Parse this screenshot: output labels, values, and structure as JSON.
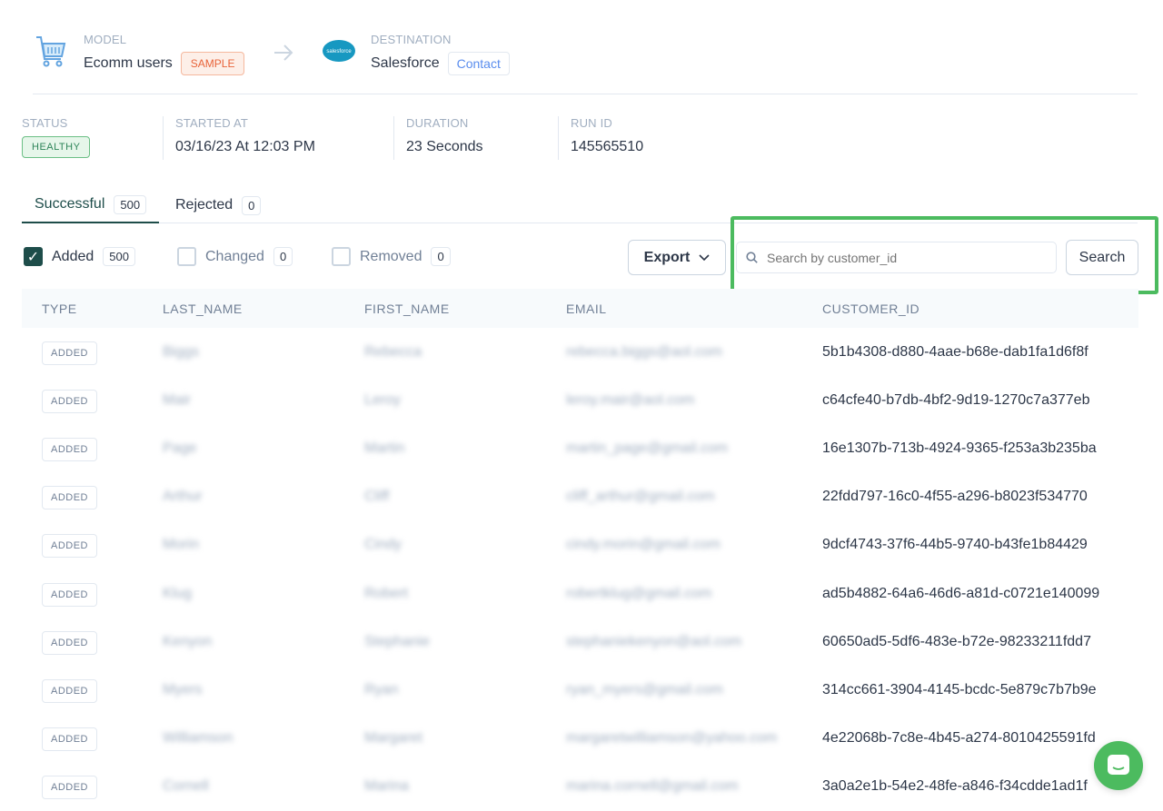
{
  "header": {
    "model_label": "MODEL",
    "model_name": "Ecomm users",
    "sample_badge": "SAMPLE",
    "destination_label": "DESTINATION",
    "destination_name": "Salesforce",
    "object_badge": "Contact"
  },
  "stats": {
    "status_label": "STATUS",
    "status_value": "HEALTHY",
    "started_label": "STARTED AT",
    "started_value": "03/16/23 At 12:03 PM",
    "duration_label": "DURATION",
    "duration_value": "23 Seconds",
    "run_label": "RUN ID",
    "run_value": "145565510"
  },
  "tabs": [
    {
      "label": "Successful",
      "count": "500"
    },
    {
      "label": "Rejected",
      "count": "0"
    }
  ],
  "filters": [
    {
      "label": "Added",
      "count": "500",
      "checked": true
    },
    {
      "label": "Changed",
      "count": "0",
      "checked": false
    },
    {
      "label": "Removed",
      "count": "0",
      "checked": false
    }
  ],
  "export_label": "Export",
  "search": {
    "placeholder": "Search by customer_id",
    "button": "Search"
  },
  "columns": [
    "TYPE",
    "LAST_NAME",
    "FIRST_NAME",
    "EMAIL",
    "CUSTOMER_ID"
  ],
  "rows": [
    {
      "type": "ADDED",
      "last": "Biggs",
      "first": "Rebecca",
      "email": "rebecca.biggs@aol.com",
      "id": "5b1b4308-d880-4aae-b68e-dab1fa1d6f8f"
    },
    {
      "type": "ADDED",
      "last": "Mair",
      "first": "Leroy",
      "email": "leroy.mair@aol.com",
      "id": "c64cfe40-b7db-4bf2-9d19-1270c7a377eb"
    },
    {
      "type": "ADDED",
      "last": "Page",
      "first": "Martin",
      "email": "martin_page@gmail.com",
      "id": "16e1307b-713b-4924-9365-f253a3b235ba"
    },
    {
      "type": "ADDED",
      "last": "Arthur",
      "first": "Cliff",
      "email": "cliff_arthur@gmail.com",
      "id": "22fdd797-16c0-4f55-a296-b8023f534770"
    },
    {
      "type": "ADDED",
      "last": "Morin",
      "first": "Cindy",
      "email": "cindy.morin@gmail.com",
      "id": "9dcf4743-37f6-44b5-9740-b43fe1b84429"
    },
    {
      "type": "ADDED",
      "last": "Klug",
      "first": "Robert",
      "email": "robertklug@gmail.com",
      "id": "ad5b4882-64a6-46d6-a81d-c0721e140099"
    },
    {
      "type": "ADDED",
      "last": "Kenyon",
      "first": "Stephanie",
      "email": "stephaniekenyon@aol.com",
      "id": "60650ad5-5df6-483e-b72e-98233211fdd7"
    },
    {
      "type": "ADDED",
      "last": "Myers",
      "first": "Ryan",
      "email": "ryan_myers@gmail.com",
      "id": "314cc661-3904-4145-bcdc-5e879c7b7b9e"
    },
    {
      "type": "ADDED",
      "last": "Williamson",
      "first": "Margaret",
      "email": "margaretwilliamson@yahoo.com",
      "id": "4e22068b-7c8e-4b45-a274-8010425591fd"
    },
    {
      "type": "ADDED",
      "last": "Cornell",
      "first": "Marina",
      "email": "marina.cornell@gmail.com",
      "id": "3a0a2e1b-54e2-48fe-a846-f34cdde1ad1f"
    }
  ],
  "colors": {
    "accent": "#1e4d4a",
    "highlight": "#4cbb5f",
    "sample": "#e8643a",
    "contact": "#5a8dee",
    "healthy": "#2f855a"
  }
}
